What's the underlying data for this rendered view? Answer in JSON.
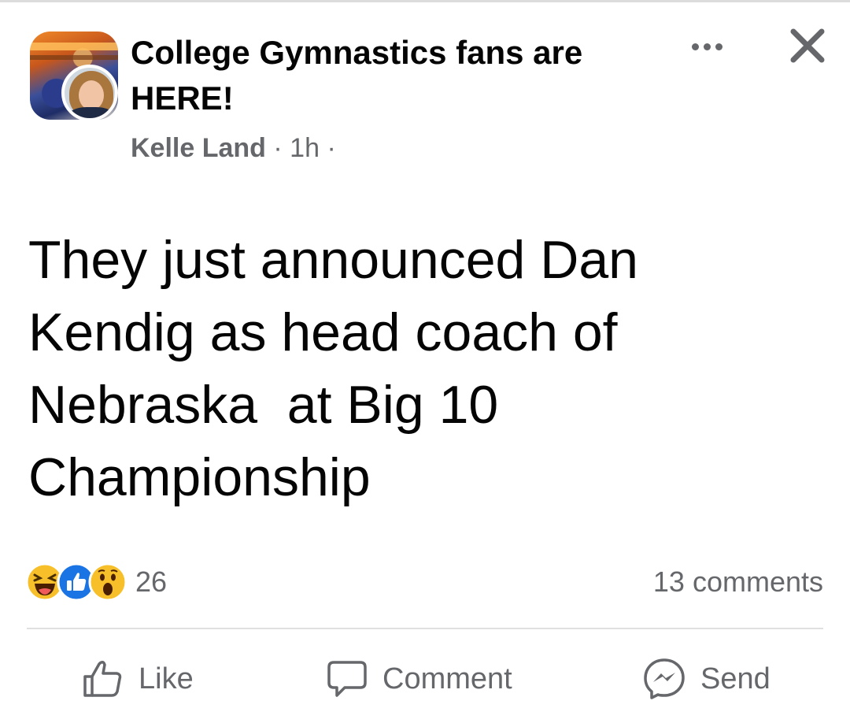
{
  "post": {
    "group_name": "College Gymnastics fans are HERE!",
    "author": "Kelle Land",
    "time": "1h",
    "separator": "·",
    "text": "They just announced Dan\nKendig as head coach of\nNebraska  at Big 10\nChampionship"
  },
  "stats": {
    "reactions": [
      "haha-icon",
      "like-icon",
      "wow-icon"
    ],
    "reaction_count": "26",
    "comments": "13 comments"
  },
  "actions": {
    "like": "Like",
    "comment": "Comment",
    "send": "Send"
  },
  "colors": {
    "text": "#050505",
    "muted": "#65676b",
    "like_blue": "#1b74e4",
    "reaction_yellow": "#f7c02b"
  }
}
